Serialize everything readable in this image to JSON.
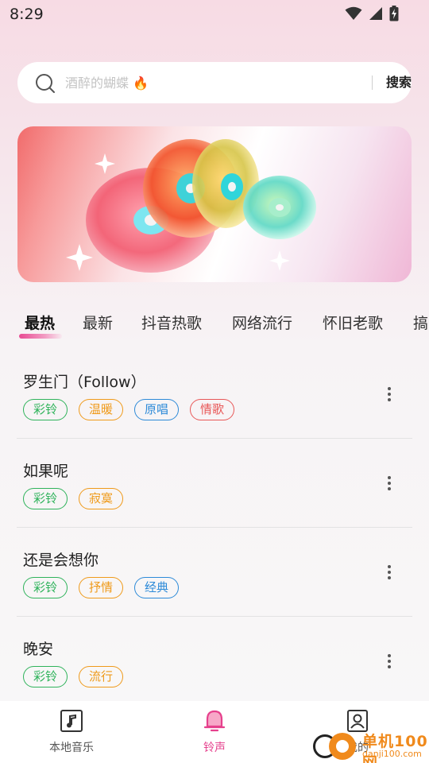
{
  "status_bar": {
    "time": "8:29",
    "icons": [
      "wifi-icon",
      "signal-icon",
      "battery-charging-icon"
    ]
  },
  "search": {
    "placeholder": "酒醉的蝴蝶 🔥",
    "button_label": "搜索"
  },
  "banner": {
    "image": "colorful-vinyl-records-banner"
  },
  "tabs": [
    {
      "label": "最热",
      "active": true
    },
    {
      "label": "最新",
      "active": false
    },
    {
      "label": "抖音热歌",
      "active": false
    },
    {
      "label": "网络流行",
      "active": false
    },
    {
      "label": "怀旧老歌",
      "active": false
    },
    {
      "label": "搞",
      "active": false
    }
  ],
  "songs": [
    {
      "title": "罗生门（Follow）",
      "tags": [
        {
          "label": "彩铃",
          "color": "#2fb35b"
        },
        {
          "label": "温暖",
          "color": "#ef9a1a"
        },
        {
          "label": "原唱",
          "color": "#2d8ad8"
        },
        {
          "label": "情歌",
          "color": "#e85757"
        }
      ]
    },
    {
      "title": "如果呢",
      "tags": [
        {
          "label": "彩铃",
          "color": "#2fb35b"
        },
        {
          "label": "寂寞",
          "color": "#ef9a1a"
        }
      ]
    },
    {
      "title": "还是会想你",
      "tags": [
        {
          "label": "彩铃",
          "color": "#2fb35b"
        },
        {
          "label": "抒情",
          "color": "#ef9a1a"
        },
        {
          "label": "经典",
          "color": "#2d8ad8"
        }
      ]
    },
    {
      "title": "晚安",
      "tags": [
        {
          "label": "彩铃",
          "color": "#2fb35b"
        },
        {
          "label": "流行",
          "color": "#ef9a1a"
        }
      ]
    }
  ],
  "bottom_nav": [
    {
      "label": "本地音乐",
      "icon": "music-note-icon",
      "active": false
    },
    {
      "label": "铃声",
      "icon": "bell-icon",
      "active": true
    },
    {
      "label": "我的",
      "icon": "profile-icon",
      "active": false
    }
  ],
  "watermark": {
    "text": "单机100网",
    "url_text": "danji100.com"
  },
  "colors": {
    "accent": "#e6418d",
    "tag_green": "#2fb35b",
    "tag_orange": "#ef9a1a",
    "tag_blue": "#2d8ad8",
    "tag_red": "#e85757"
  }
}
